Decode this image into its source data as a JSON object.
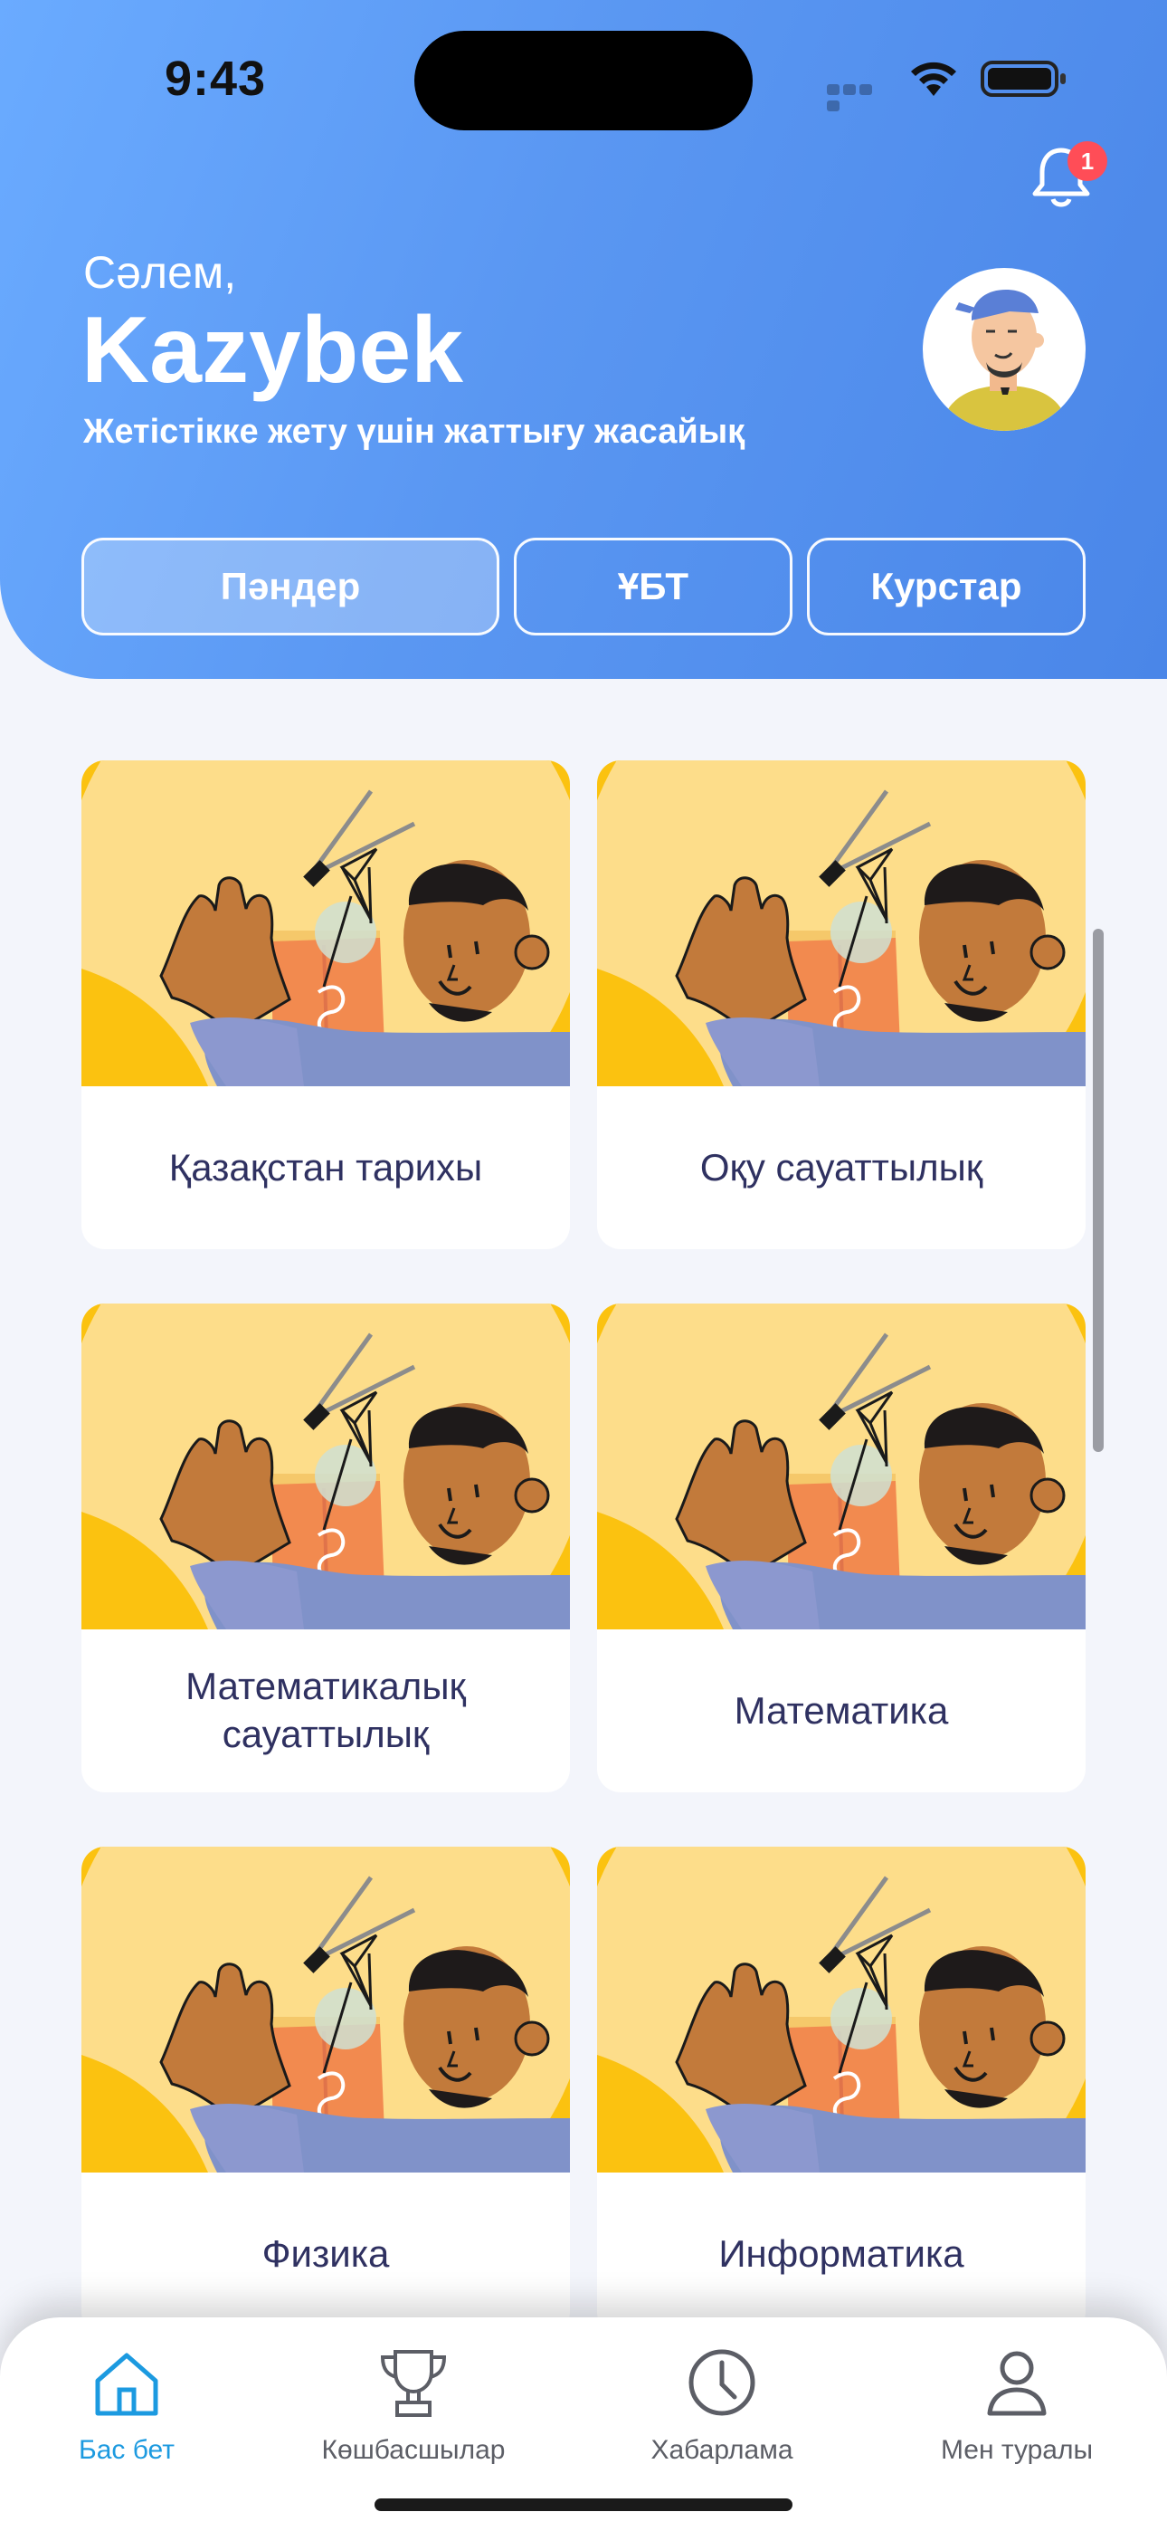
{
  "status": {
    "time": "9:43",
    "signal_icon": "cellular-signal-icon",
    "wifi_icon": "wifi-icon",
    "battery_icon": "battery-icon"
  },
  "header": {
    "greeting": "Сәлем,",
    "username": "Kazybek",
    "subtitle": "Жетістікке жету үшін жаттығу жасайық",
    "notification_count": "1",
    "bell_icon": "bell-icon",
    "avatar_icon": "user-avatar-illustration"
  },
  "tabs": [
    {
      "label": "Пәндер",
      "active": true
    },
    {
      "label": "ҰБТ",
      "active": false
    },
    {
      "label": "Курстар",
      "active": false
    }
  ],
  "subjects": [
    {
      "title": "Қазақстан тарихы"
    },
    {
      "title": "Оқу сауаттылық"
    },
    {
      "title": "Математикалық сауаттылық"
    },
    {
      "title": "Математика"
    },
    {
      "title": "Физика"
    },
    {
      "title": "Информатика"
    }
  ],
  "nav": [
    {
      "label": "Бас бет",
      "icon": "home-icon",
      "active": true
    },
    {
      "label": "Көшбасшылар",
      "icon": "trophy-icon",
      "active": false
    },
    {
      "label": "Хабарлама",
      "icon": "clock-icon",
      "active": false
    },
    {
      "label": "Мен туралы",
      "icon": "profile-icon",
      "active": false
    }
  ],
  "colors": {
    "header_gradient_start": "#6aabff",
    "header_gradient_end": "#4a86e8",
    "active_nav": "#1c9ae0",
    "badge": "#ff4d57",
    "background": "#f3f5fb"
  }
}
